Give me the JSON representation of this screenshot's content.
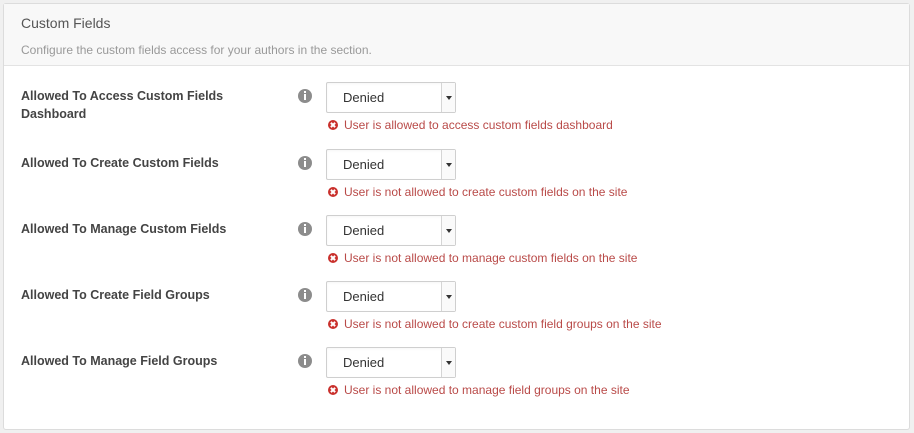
{
  "panel": {
    "title": "Custom Fields",
    "description": "Configure the custom fields access for your authors in the section."
  },
  "settings": [
    {
      "label": "Allowed To Access Custom Fields Dashboard",
      "value": "Denied",
      "message": "User is allowed to access custom fields dashboard"
    },
    {
      "label": "Allowed To Create Custom Fields",
      "value": "Denied",
      "message": "User is not allowed to create custom fields on the site"
    },
    {
      "label": "Allowed To Manage Custom Fields",
      "value": "Denied",
      "message": "User is not allowed to manage custom fields on the site"
    },
    {
      "label": "Allowed To Create Field Groups",
      "value": "Denied",
      "message": "User is not allowed to create custom field groups on the site"
    },
    {
      "label": "Allowed To Manage Field Groups",
      "value": "Denied",
      "message": "User is not allowed to manage field groups on the site"
    }
  ],
  "icons": {
    "info": "info-icon",
    "error": "error-circle-icon",
    "dropdown": "caret-down-icon"
  },
  "colors": {
    "error": "#b94a48",
    "info_icon": "#8c8c8c"
  }
}
